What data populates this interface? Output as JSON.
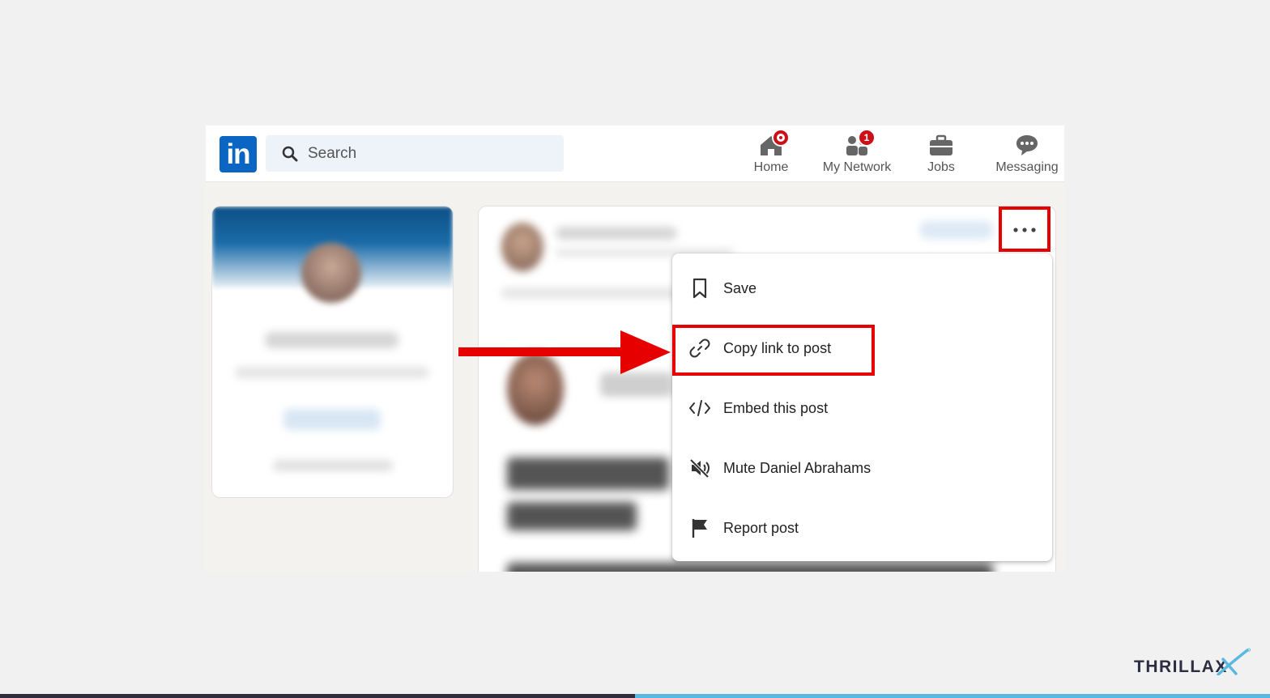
{
  "header": {
    "logo_text": "in",
    "search_placeholder": "Search",
    "nav": [
      {
        "label": "Home",
        "icon": "home-icon",
        "badge": ""
      },
      {
        "label": "My Network",
        "icon": "network-icon",
        "badge": "1"
      },
      {
        "label": "Jobs",
        "icon": "briefcase-icon",
        "badge": ""
      },
      {
        "label": "Messaging",
        "icon": "chat-icon",
        "badge": ""
      }
    ]
  },
  "post_menu": {
    "items": [
      {
        "label": "Save",
        "icon": "bookmark-icon"
      },
      {
        "label": "Copy link to post",
        "icon": "link-icon"
      },
      {
        "label": "Embed this post",
        "icon": "code-icon"
      },
      {
        "label": "Mute Daniel Abrahams",
        "icon": "mute-icon"
      },
      {
        "label": "Report post",
        "icon": "flag-icon"
      }
    ]
  },
  "annotation": {
    "highlight_color": "#e60000"
  },
  "brand": {
    "name": "THRILLAX",
    "colors": {
      "dark": "#2f2d3e",
      "accent": "#5bb8e0"
    }
  }
}
